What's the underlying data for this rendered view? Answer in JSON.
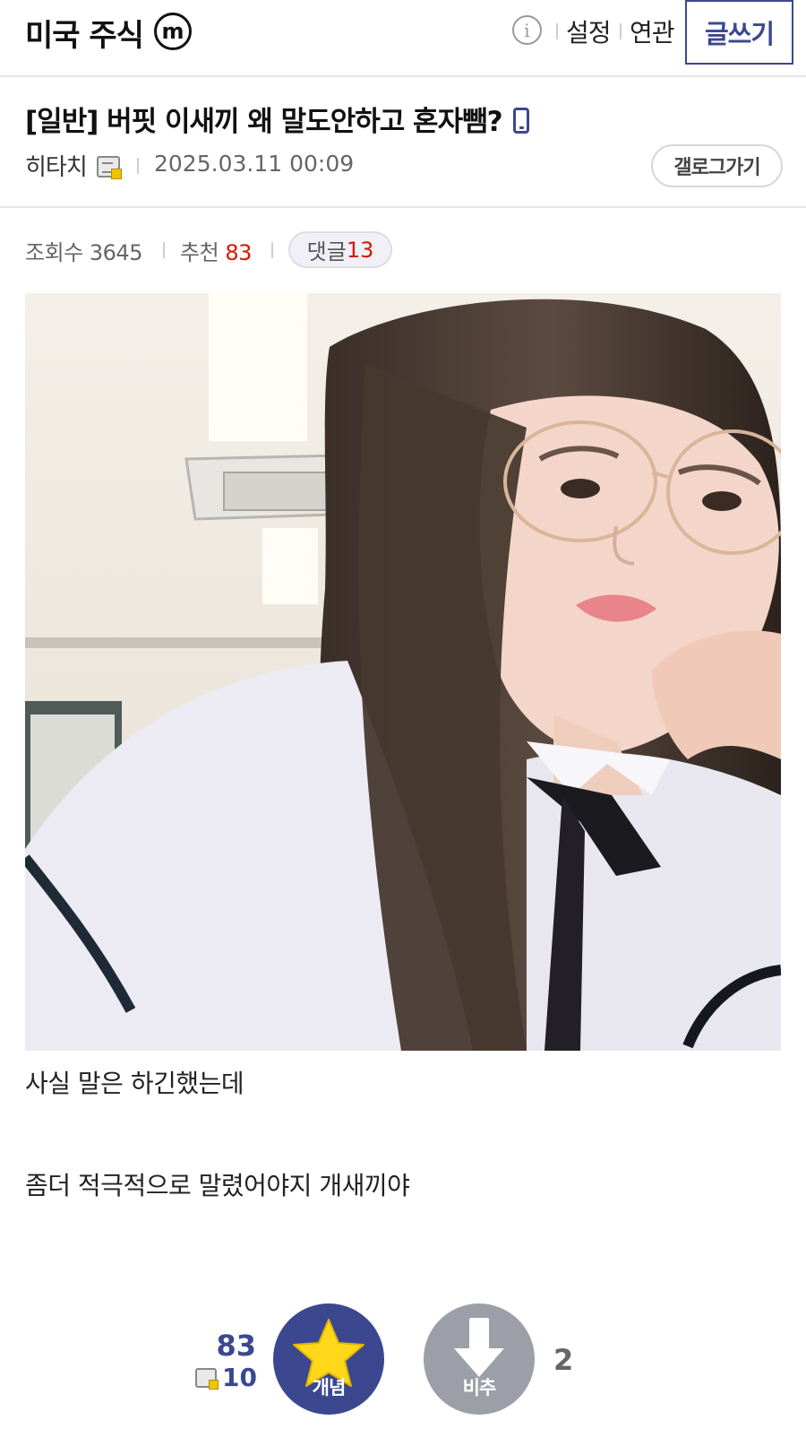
{
  "header": {
    "gallery_title": "미국 주식",
    "minor_badge": "m",
    "info_icon": "i",
    "settings_label": "설정",
    "related_label": "연관",
    "write_button_label": "글쓰기"
  },
  "post": {
    "title": "[일반] 버핏 이새끼 왜 말도안하고 혼자뺌?",
    "writer": "히타치",
    "date": "2025.03.11 00:09",
    "gallog_button_label": "갤로그가기",
    "views_label": "조회수",
    "views": "3645",
    "recommend_label": "추천",
    "recommend": "83",
    "comments_label": "댓글",
    "comments": "13",
    "body_lines": [
      "사실 말은 하긴했는데",
      "좀더 적극적으로 말렸어야지 개새끼야"
    ]
  },
  "vote": {
    "upvote_count": "83",
    "fixed_upvote_count": "10",
    "upvote_label": "개념",
    "downvote_label": "비추",
    "downvote_count": "2"
  },
  "colors": {
    "brand": "#3b4890",
    "recommend_red": "#d31900",
    "downvote_gray": "#9d9fa8"
  },
  "icons": [
    "minor-gallery-icon",
    "info-icon",
    "mobile-icon",
    "gallog-icon",
    "star-icon",
    "down-arrow-icon"
  ]
}
